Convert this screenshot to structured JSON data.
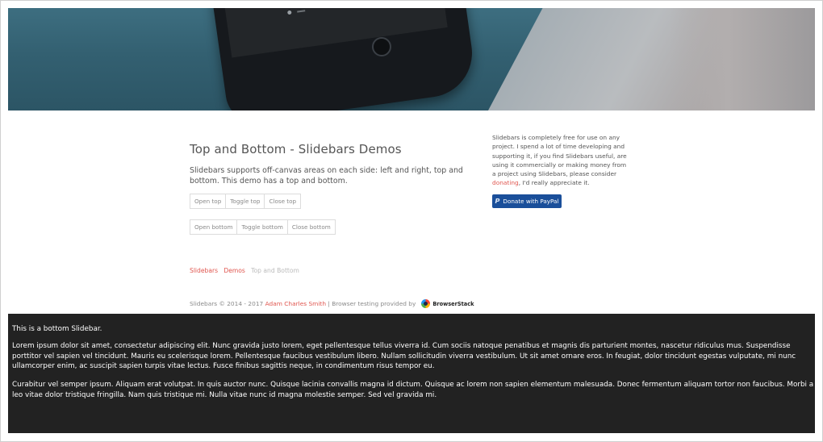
{
  "hero": {
    "image_desc": "phone-on-desk-photo"
  },
  "main": {
    "title": "Top and Bottom - Slidebars Demos",
    "lead": "Slidebars supports off-canvas areas on each side: left and right, top and bottom. This demo has a top and bottom.",
    "top_buttons": [
      "Open top",
      "Toggle top",
      "Close top"
    ],
    "bottom_buttons": [
      "Open bottom",
      "Toggle bottom",
      "Close bottom"
    ]
  },
  "breadcrumb": {
    "items": [
      "Slidebars",
      "Demos",
      "Top and Bottom"
    ]
  },
  "footer": {
    "prefix": "Slidebars © 2014 - 2017",
    "author": "Adam Charles Smith",
    "suffix": "| Browser testing provided by",
    "sponsor": "BrowserStack"
  },
  "aside": {
    "text_before": "Slidebars is completely free for use on any project. I spend a lot of time developing and supporting it, if you find Slidebars useful, are using it commercially or making money from a project using Slidebars, please consider",
    "link": "donating",
    "text_after": ", I'd really appreciate it.",
    "donate_label": "Donate with PayPal",
    "donate_icon": "paypal-icon"
  },
  "bottom_slidebar": {
    "heading": "This is a bottom Slidebar.",
    "p1": "Lorem ipsum dolor sit amet, consectetur adipiscing elit. Nunc gravida justo lorem, eget pellentesque tellus viverra id. Cum sociis natoque penatibus et magnis dis parturient montes, nascetur ridiculus mus. Suspendisse porttitor vel sapien vel tincidunt. Mauris eu scelerisque lorem. Pellentesque faucibus vestibulum libero. Nullam sollicitudin viverra vestibulum. Ut sit amet ornare eros. In feugiat, dolor tincidunt egestas vulputate, mi nunc ullamcorper enim, ac suscipit sapien turpis vitae lectus. Fusce finibus sagittis neque, in condimentum risus tempor eu.",
    "p2": "Curabitur vel semper ipsum. Aliquam erat volutpat. In quis auctor nunc. Quisque lacinia convallis magna id dictum. Quisque ac lorem non sapien elementum malesuada. Donec fermentum aliquam tortor non faucibus. Morbi a leo vitae dolor tristique fringilla. Nam quis tristique mi. Nulla vitae nunc id magna molestie semper. Sed vel gravida mi."
  },
  "colors": {
    "accent_link": "#e0564f",
    "bottom_bar_bg": "#222222",
    "paypal_bg": "#1a4f9a"
  }
}
